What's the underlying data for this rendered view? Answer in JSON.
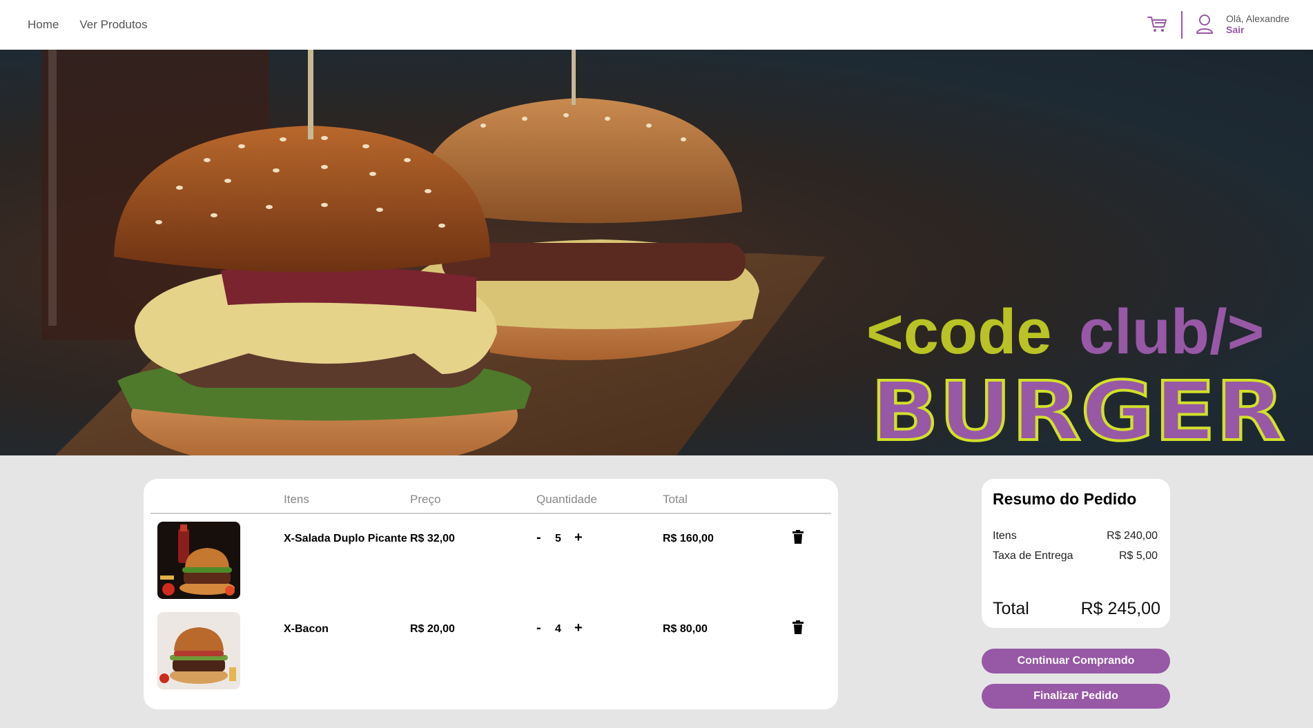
{
  "nav": {
    "home": "Home",
    "products": "Ver Produtos"
  },
  "user": {
    "greeting": "Olá, Alexandre",
    "logout": "Sair"
  },
  "brand": {
    "line1_a": "<code",
    "line1_b": "club/>",
    "line2": "BURGER"
  },
  "colors": {
    "purple": "#9758a6",
    "lime": "#b9c325"
  },
  "cart": {
    "headers": [
      "Itens",
      "Preço",
      "Quantidade",
      "Total"
    ],
    "items": [
      {
        "name": "X-Salada Duplo Picante",
        "price": "R$ 32,00",
        "quantity": "5",
        "total": "R$ 160,00"
      },
      {
        "name": "X-Bacon",
        "price": "R$ 20,00",
        "quantity": "4",
        "total": "R$ 80,00"
      }
    ],
    "minus": "-",
    "plus": "+"
  },
  "summary": {
    "title": "Resumo do Pedido",
    "items_label": "Itens",
    "items_value": "R$ 240,00",
    "delivery_label": "Taxa de Entrega",
    "delivery_value": "R$ 5,00",
    "total_label": "Total",
    "total_value": "R$ 245,00"
  },
  "buttons": {
    "continue": "Continuar Comprando",
    "checkout": "Finalizar Pedido"
  },
  "icons": [
    "cart-icon",
    "user-icon",
    "trash-icon"
  ]
}
